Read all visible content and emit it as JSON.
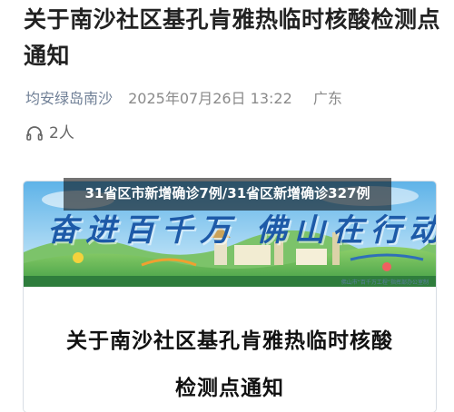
{
  "article": {
    "title": "关于南沙社区基孔肯雅热临时核酸检测点通知",
    "author": "均安绿岛南沙",
    "datetime": "2025年07月26日 13:22",
    "location": "广东",
    "listeners": "2人",
    "listen_icon": "headphones-icon"
  },
  "banner": {
    "slogan": "奋进百千万 佛山在行动",
    "caption": "佛山市“百千万工程”指挥部办公室制"
  },
  "notice": {
    "line1": "关于南沙社区基孔肯雅热临时核酸",
    "line2": "检测点通知"
  },
  "overlay": {
    "headline": "31省区市新增确诊7例/31省区新增确诊327例"
  },
  "colors": {
    "title": "#222222",
    "meta": "#8a8a8a",
    "author": "#6f7f96",
    "slogan": "#1d5aa8",
    "overlay_bg": "rgba(0,0,0,0.55)"
  }
}
